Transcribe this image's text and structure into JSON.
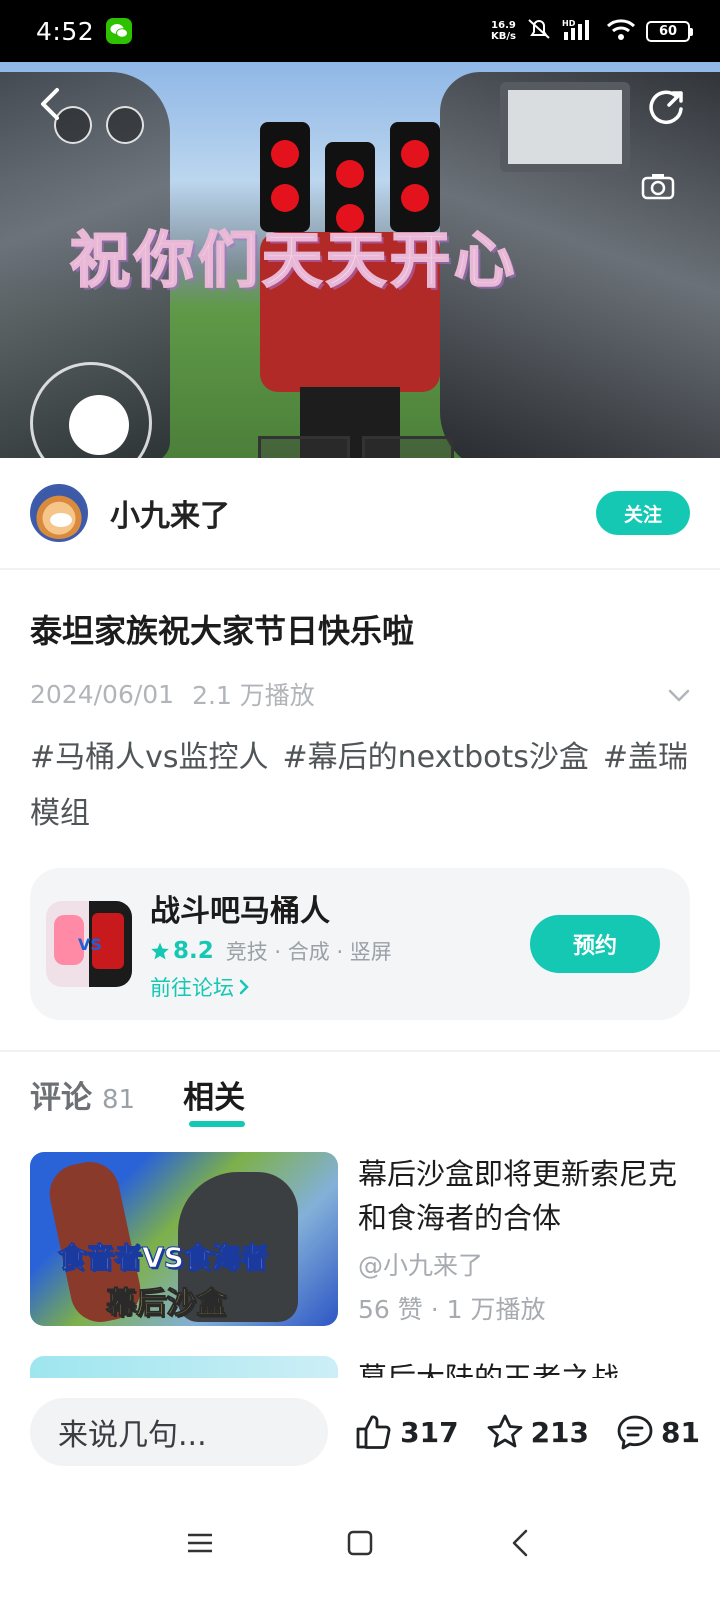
{
  "status_bar": {
    "time": "4:52",
    "net_speed_value": "16.9",
    "net_speed_unit": "KB/s",
    "battery": "60"
  },
  "video": {
    "overlay_text": "祝你们天天开心"
  },
  "author": {
    "name": "小九来了",
    "follow_label": "关注"
  },
  "post": {
    "title": "泰坦家族祝大家节日快乐啦",
    "date": "2024/06/01",
    "views": "2.1 万播放",
    "hashtags": [
      "#马桶人vs监控人",
      "#幕后的nextbots沙盒",
      "#盖瑞模组"
    ]
  },
  "game": {
    "name": "战斗吧马桶人",
    "rating": "8.2",
    "tags": "竞技 · 合成 · 竖屏",
    "forum_link": "前往论坛",
    "reserve_label": "预约",
    "icon_vs": "VS"
  },
  "tabs": [
    {
      "label": "评论",
      "count": "81"
    },
    {
      "label": "相关"
    }
  ],
  "related": [
    {
      "title": "幕后沙盒即将更新索尼克和食海者的合体",
      "author": "@小九来了",
      "stats": "56 赞 · 1 万播放",
      "thumb_line1": "食音者VS食海者",
      "thumb_line2": "幕后沙盒"
    },
    {
      "title": "幕后大陆的王者之战"
    }
  ],
  "bottom_bar": {
    "comment_placeholder": "来说几句...",
    "likes": "317",
    "favorites": "213",
    "comments": "81"
  },
  "colors": {
    "accent": "#15c8b4"
  }
}
